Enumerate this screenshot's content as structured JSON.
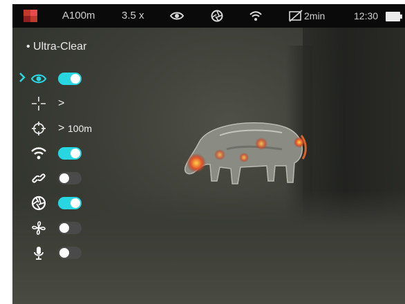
{
  "status_bar": {
    "palette_icon": "palette-icon",
    "mode": "A100m",
    "zoom": "3.5 x",
    "time_remaining": "2min",
    "clock": "12:30"
  },
  "menu": {
    "mode_label": "• Ultra-Clear",
    "rows": [
      {
        "icon": "eye-icon",
        "control": "toggle",
        "state": "on",
        "selected": true
      },
      {
        "icon": "reticle-icon",
        "control": "submenu",
        "chevron": ">"
      },
      {
        "icon": "rangefinder-icon",
        "control": "submenu",
        "chevron": ">",
        "value": "100m"
      },
      {
        "icon": "wifi-icon",
        "control": "toggle",
        "state": "on"
      },
      {
        "icon": "link-icon",
        "control": "toggle",
        "state": "off"
      },
      {
        "icon": "shutter-icon",
        "control": "toggle",
        "state": "on"
      },
      {
        "icon": "fan-icon",
        "control": "toggle",
        "state": "off"
      },
      {
        "icon": "microphone-icon",
        "control": "toggle",
        "state": "off"
      }
    ]
  },
  "colors": {
    "accent": "#27d6e0",
    "toggle_off": "#4a4a4a",
    "status_bg": "#0a0a0a"
  }
}
